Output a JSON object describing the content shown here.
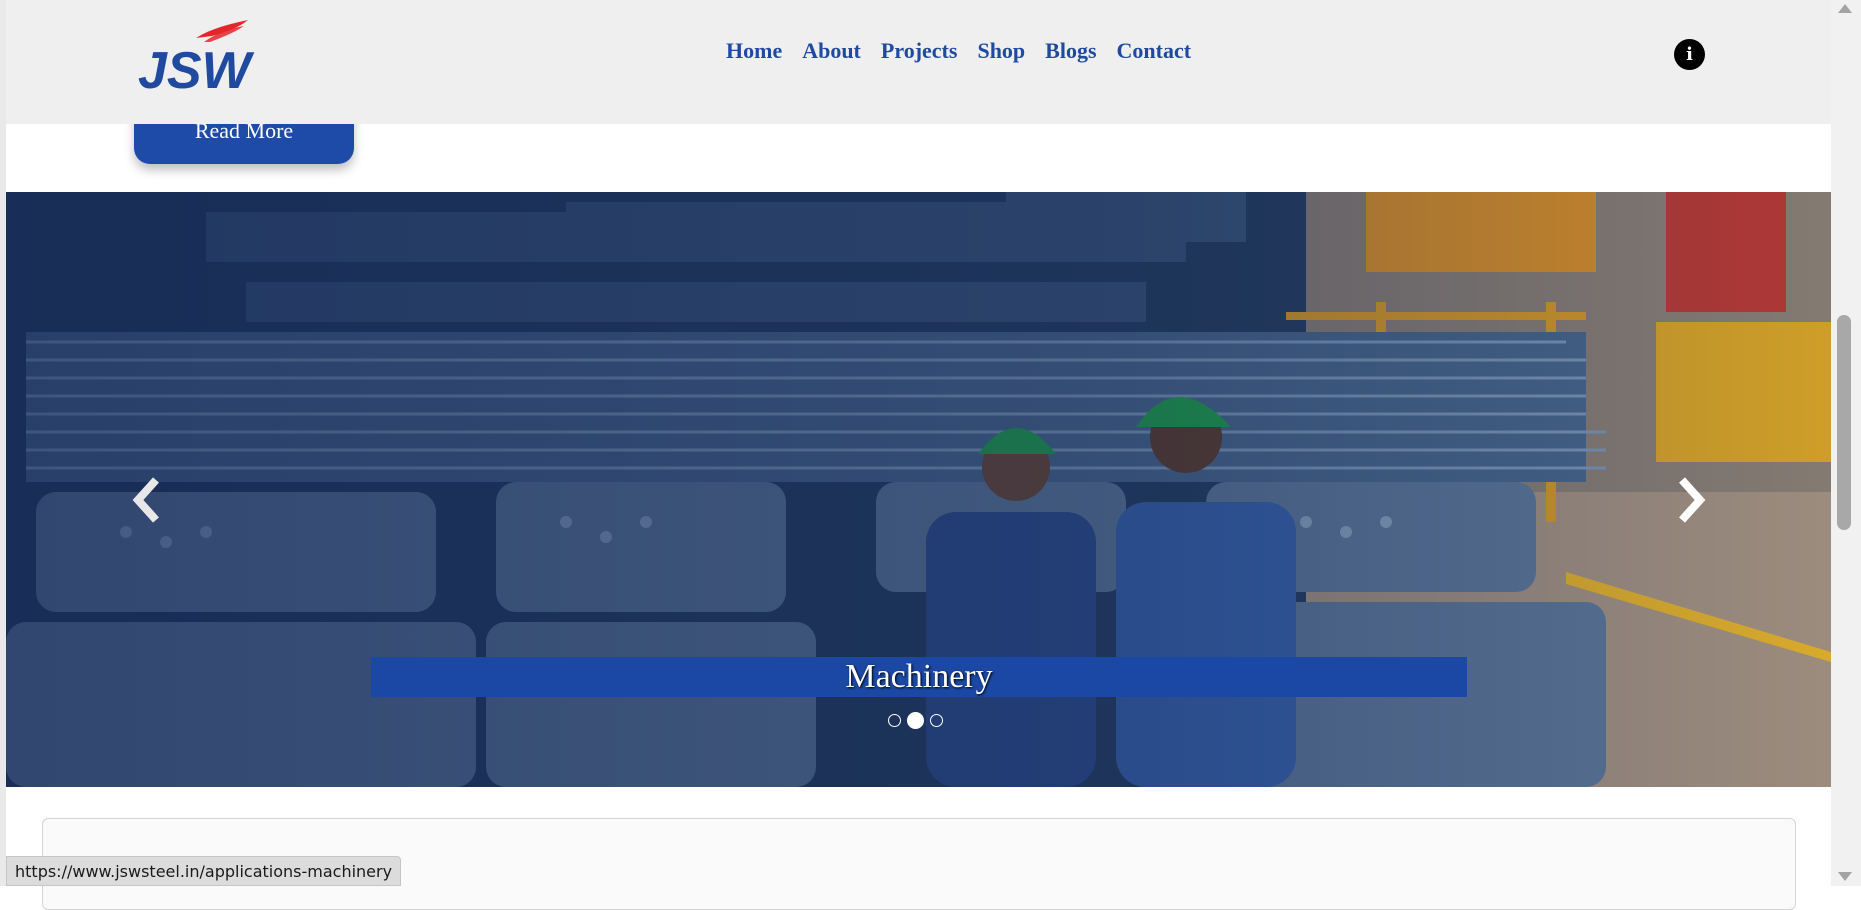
{
  "header": {
    "logo_text": "JSW",
    "nav": [
      "Home",
      "About",
      "Projects",
      "Shop",
      "Blogs",
      "Contact"
    ],
    "info_icon": "info-icon"
  },
  "read_more_label": "Read More",
  "carousel": {
    "caption": "Machinery",
    "slide_count": 3,
    "active_slide": 2,
    "prev_icon": "chevron-left-icon",
    "next_icon": "chevron-right-icon"
  },
  "status_bar": {
    "url": "https://www.jswsteel.in/applications-machinery"
  },
  "colors": {
    "brand_blue": "#1f4aa0",
    "caption_bg": "#1b48a4",
    "logo_red": "#e4262c",
    "header_bg": "#efefef"
  }
}
